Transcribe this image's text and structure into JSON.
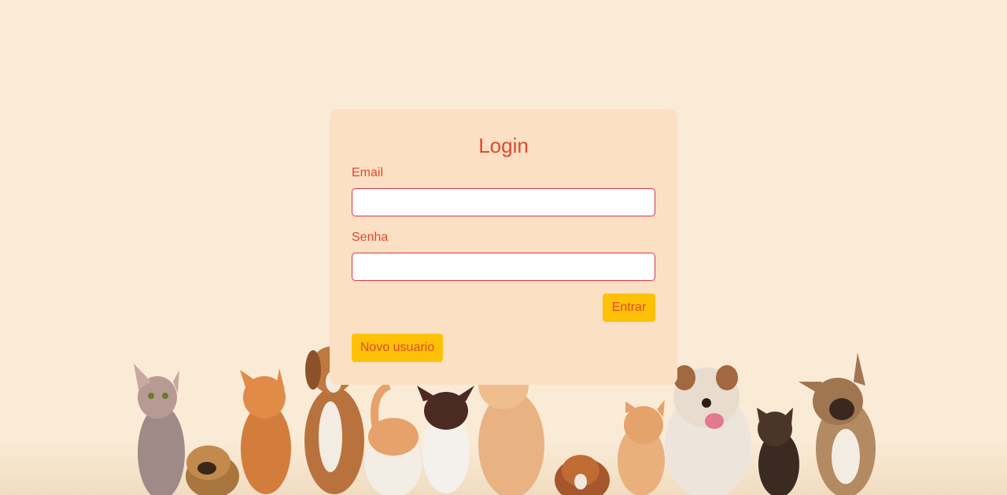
{
  "login": {
    "title": "Login",
    "email_label": "Email",
    "email_value": "",
    "senha_label": "Senha",
    "senha_value": "",
    "entrar_label": "Entrar",
    "novo_usuario_label": "Novo usuario"
  },
  "colors": {
    "background": "#faebd7",
    "card": "#fce0c4",
    "accent_text": "#e0492e",
    "button": "#ffc107",
    "input_border": "#dc3545"
  },
  "background_image": {
    "animals": [
      "sphynx-cat",
      "pekingese-dog",
      "orange-tabby-cat",
      "jack-russell-dog",
      "exotic-shorthair-cat",
      "chihuahua-dog",
      "cream-cat",
      "cavalier-puppy",
      "orange-kitten",
      "english-bulldog",
      "tortoiseshell-kitten",
      "french-bulldog"
    ]
  }
}
